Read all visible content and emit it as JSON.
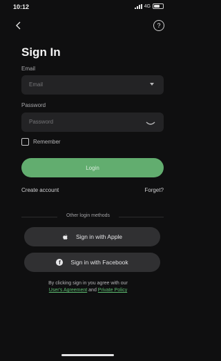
{
  "status_bar": {
    "time": "10:12",
    "network": "4G"
  },
  "header": {
    "title": "Sign In"
  },
  "form": {
    "email_label": "Email",
    "email_placeholder": "Email",
    "password_label": "Password",
    "password_placeholder": "Password",
    "remember_label": "Remember",
    "login_button": "Login",
    "create_account": "Create account",
    "forget": "Forget?"
  },
  "other_login": {
    "title": "Other login methods",
    "apple": "Sign in with Apple",
    "facebook": "Sign in with Facebook"
  },
  "terms": {
    "line1": "By clicking sign in you agree with our",
    "user_agreement": "User's Agreement",
    "and": "and",
    "privacy_policy": "Private Policy"
  },
  "colors": {
    "background": "#0f0f10",
    "accent": "#62ad6f",
    "field": "#232325",
    "social": "#303032"
  }
}
